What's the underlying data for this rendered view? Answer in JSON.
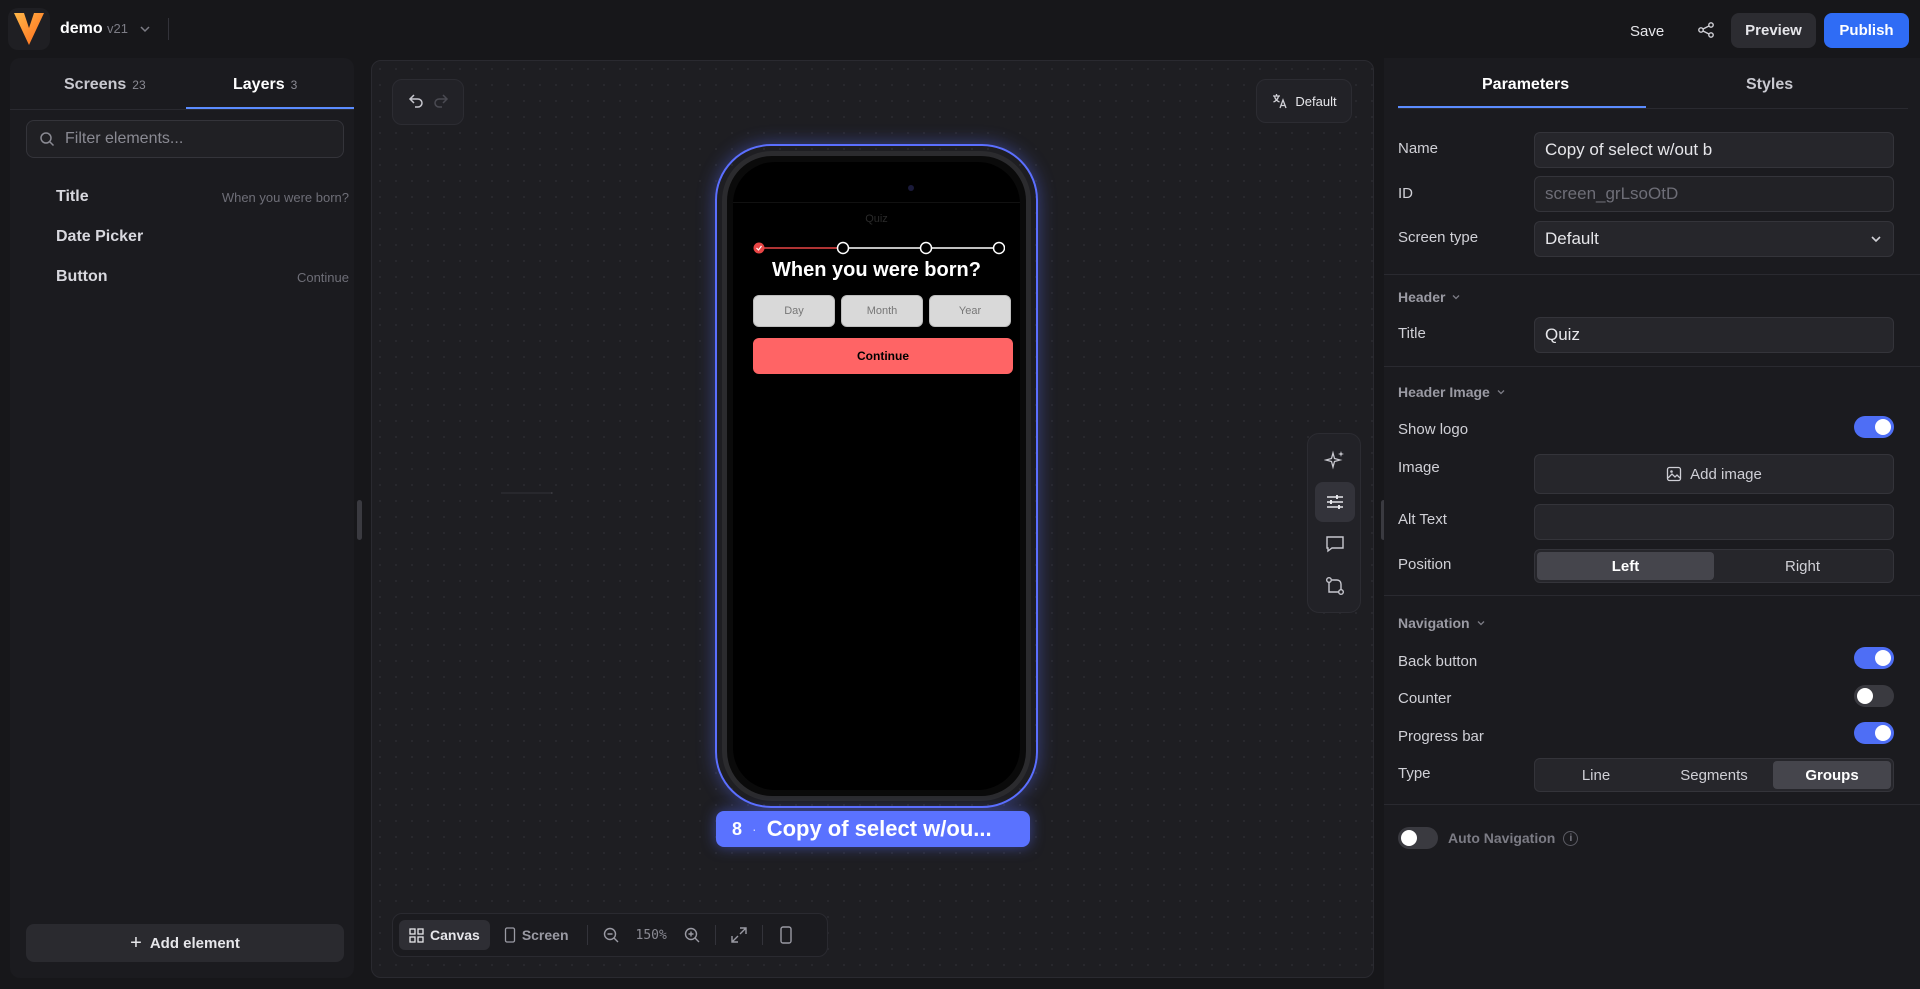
{
  "app": {
    "project_name": "demo",
    "version": "v21",
    "save_label": "Save",
    "preview_label": "Preview",
    "publish_label": "Publish",
    "accent": "#2f6cf5"
  },
  "left_panel": {
    "tabs": [
      {
        "label": "Screens",
        "count": "23"
      },
      {
        "label": "Layers",
        "count": "3"
      }
    ],
    "filter_placeholder": "Filter elements...",
    "layers": [
      {
        "name": "Title",
        "value": "When you were born?"
      },
      {
        "name": "Date Picker",
        "value": ""
      },
      {
        "name": "Button",
        "value": "Continue"
      }
    ],
    "add_element_label": "Add element"
  },
  "canvas": {
    "language_label": "Default",
    "phone": {
      "header_title": "Quiz",
      "question": "When you were born?",
      "date_fields": [
        "Day",
        "Month",
        "Year"
      ],
      "button_label": "Continue",
      "progress": {
        "groups": 4,
        "current": 1,
        "active_color": "#e94545"
      }
    },
    "screen_tag": {
      "number": "8",
      "name": "Copy of select w/ou..."
    },
    "bottom_bar": {
      "canvas_label": "Canvas",
      "screen_label": "Screen",
      "zoom": "150%"
    }
  },
  "right_panel": {
    "tabs": [
      "Parameters",
      "Styles"
    ],
    "name_label": "Name",
    "name_value": "Copy of select w/out b",
    "id_label": "ID",
    "id_value": "screen_grLsoOtD",
    "screen_type_label": "Screen type",
    "screen_type_value": "Default",
    "header_section": "Header",
    "title_label": "Title",
    "title_value": "Quiz",
    "header_image_section": "Header Image",
    "show_logo_label": "Show logo",
    "show_logo": true,
    "image_label": "Image",
    "add_image_label": "Add image",
    "alt_text_label": "Alt Text",
    "alt_text_value": "",
    "position_label": "Position",
    "position_options": [
      "Left",
      "Right"
    ],
    "position_selected": "Left",
    "navigation_section": "Navigation",
    "back_button_label": "Back button",
    "back_button": true,
    "counter_label": "Counter",
    "counter": false,
    "progress_bar_label": "Progress bar",
    "progress_bar": true,
    "type_label": "Type",
    "type_options": [
      "Line",
      "Segments",
      "Groups"
    ],
    "type_selected": "Groups",
    "auto_navigation_label": "Auto Navigation",
    "auto_navigation": false,
    "toggle_on_color": "#4e6ef5"
  }
}
